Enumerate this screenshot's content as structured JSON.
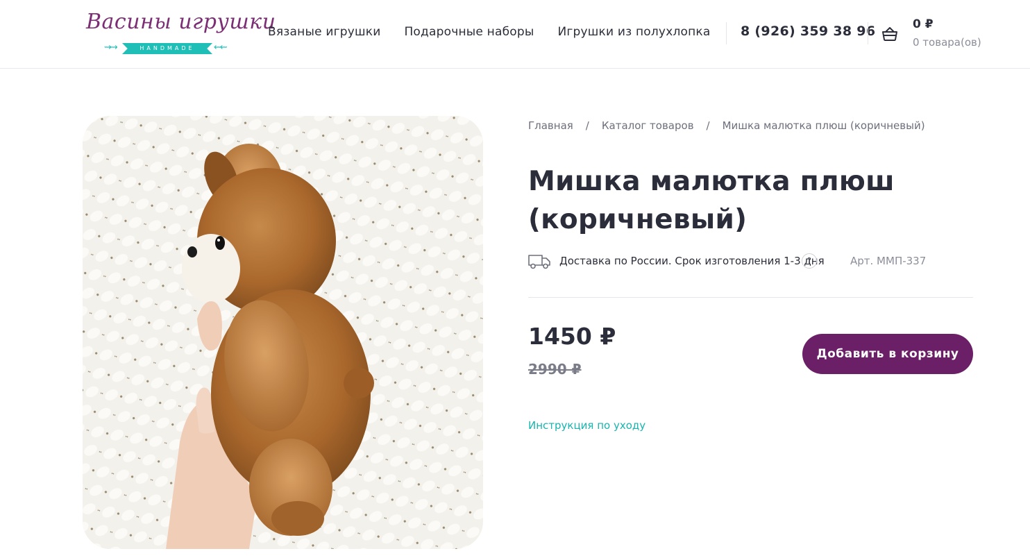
{
  "header": {
    "logo": {
      "script_text": "Васины игрушки",
      "ribbon_text": "HANDMADE",
      "brand_purple": "#7b2e74",
      "brand_teal": "#1fbfb8"
    },
    "nav": [
      {
        "label": "Вязаные игрушки"
      },
      {
        "label": "Подарочные наборы"
      },
      {
        "label": "Игрушки из полухлопка"
      }
    ],
    "phone": "8 (926) 359 38 96",
    "cart": {
      "icon": "basket-icon",
      "total": "0 ₽",
      "count": "0 товара(ов)"
    }
  },
  "product": {
    "image": "brown plush teddy bear held in hand",
    "breadcrumb": [
      {
        "label": "Главная"
      },
      {
        "label": "Каталог товаров"
      },
      {
        "label": "Мишка малютка плюш (коричневый)"
      }
    ],
    "breadcrumb_separator": "/",
    "title": "Мишка малютка плюш (коричневый)",
    "delivery_icon": "truck-icon",
    "delivery_text": "Доставка по России. Срок изготовления 1-3 дня",
    "help_badge": "?",
    "sku": "Арт. ММП-337",
    "price": "1450 ₽",
    "old_price": "2990 ₽",
    "add_to_cart_label": "Добавить в корзину",
    "care_link": "Инструкция по уходу",
    "accent_button": "#6b1f66",
    "accent_link": "#17b5ad"
  }
}
